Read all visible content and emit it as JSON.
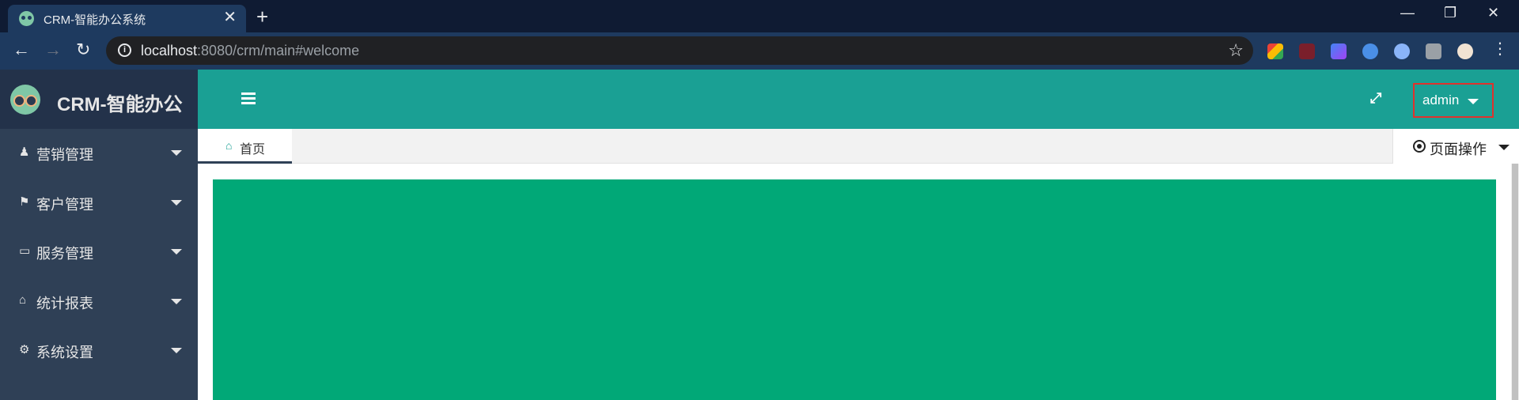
{
  "browser": {
    "tab_title": "CRM-智能办公系统",
    "tab_close": "✕",
    "new_tab": "+",
    "url_host": "localhost",
    "url_rest": ":8080/crm/main#welcome",
    "controls": {
      "minimize": "—",
      "restore": "❐",
      "close": "✕"
    },
    "nav": {
      "back": "←",
      "forward": "→",
      "reload": "↻"
    },
    "star": "☆"
  },
  "app": {
    "logo_text": "CRM-智能办公",
    "menu": [
      {
        "label": "营销管理",
        "icon": "user-tie-icon",
        "glyph": "♟"
      },
      {
        "label": "客户管理",
        "icon": "flag-icon",
        "glyph": "⚑"
      },
      {
        "label": "服务管理",
        "icon": "desktop-icon",
        "glyph": "▭"
      },
      {
        "label": "统计报表",
        "icon": "home-icon",
        "glyph": "⌂"
      },
      {
        "label": "系统设置",
        "icon": "gears-icon",
        "glyph": "⚙"
      }
    ],
    "header": {
      "fullscreen_glyph": "⤢",
      "username": "admin"
    },
    "tabs": {
      "home_label": "首页",
      "home_glyph": "⌂",
      "page_ops_label": "页面操作"
    }
  },
  "colors": {
    "sidebar": "#2f4056",
    "header": "#1aa094",
    "welcome_panel": "#01a877",
    "highlight_border": "#e0322c"
  }
}
